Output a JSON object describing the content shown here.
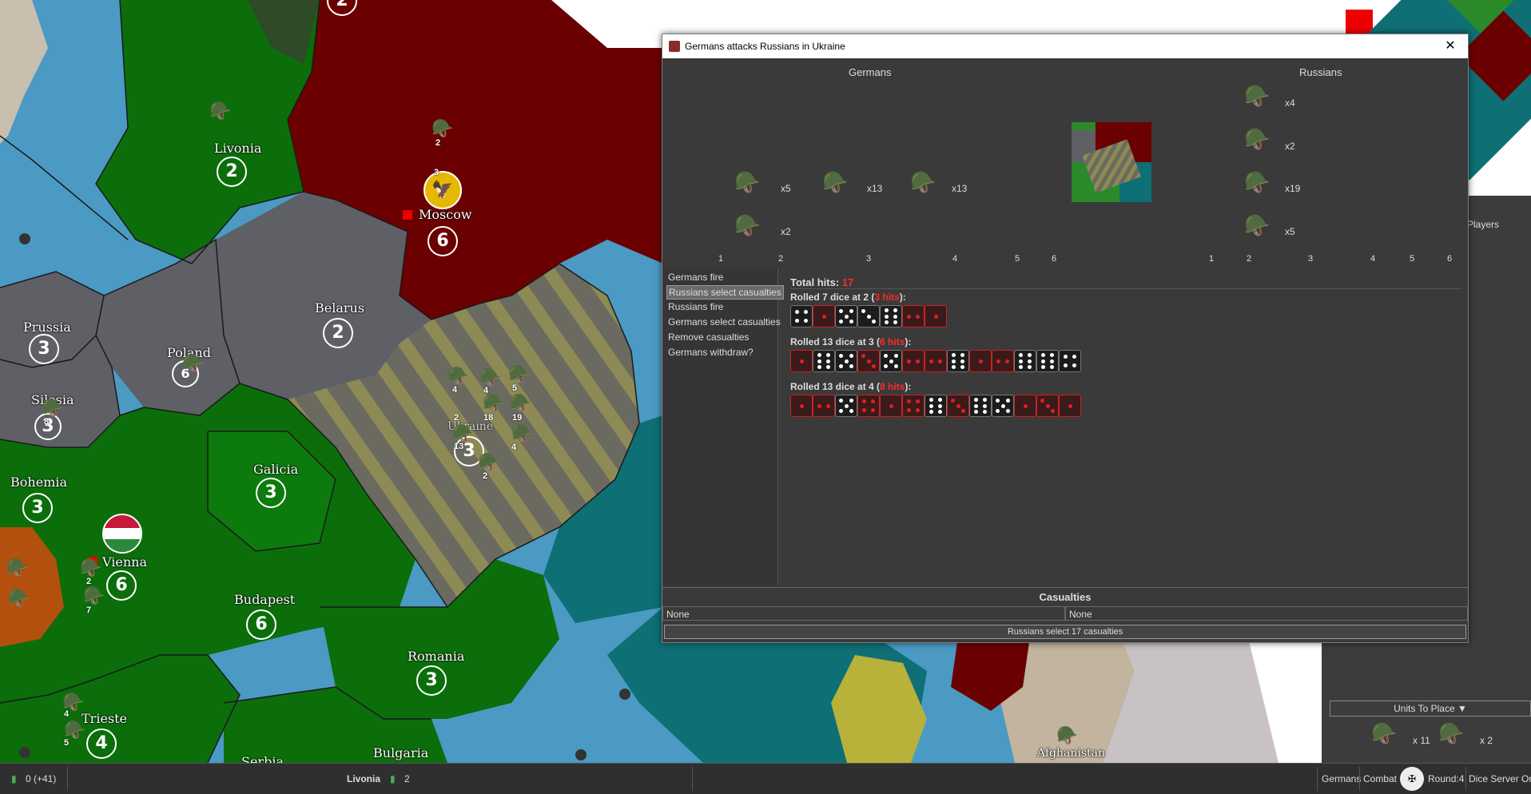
{
  "map": {
    "territories": [
      {
        "name": "Livonia",
        "pu": "2"
      },
      {
        "name": "Moscow",
        "pu": "6"
      },
      {
        "name": "Prussia",
        "pu": "3"
      },
      {
        "name": "Poland",
        "pu": "6"
      },
      {
        "name": "Belarus",
        "pu": "2"
      },
      {
        "name": "Silesia",
        "pu": "3"
      },
      {
        "name": "Ukraine",
        "pu": "3"
      },
      {
        "name": "Bohemia",
        "pu": "3"
      },
      {
        "name": "Galicia",
        "pu": "3"
      },
      {
        "name": "Vienna",
        "pu": "6"
      },
      {
        "name": "Budapest",
        "pu": "6"
      },
      {
        "name": "Romania",
        "pu": "3"
      },
      {
        "name": "Trieste",
        "pu": "4"
      },
      {
        "name": "Bulgaria",
        "pu": ""
      },
      {
        "name": "Serbia",
        "pu": ""
      },
      {
        "name": "Afghanistan",
        "pu": ""
      }
    ],
    "top_pu": "2",
    "unit_counts": {
      "moscow_top": "2",
      "moscow_mid": "3",
      "poland": "8",
      "ukraine_a": "4",
      "ukraine_b": "4",
      "ukraine_c": "5",
      "ukraine_d": "2",
      "ukraine_e": "18",
      "ukraine_f": "19",
      "ukraine_g": "13",
      "ukraine_h": "4",
      "ukraine_i": "2",
      "vienna_a": "2",
      "vienna_b": "7",
      "trieste_a": "4",
      "trieste_b": "5"
    },
    "colors": {
      "german": "#0b6e0b",
      "russian": "#6b0000",
      "neutral": "#5f5f66",
      "sea": "#4a9ac4",
      "teal": "#0e6f75"
    }
  },
  "dialog": {
    "title": "Germans attacks Russians in Ukraine",
    "close": "✕",
    "attacker": {
      "name": "Germans",
      "units": [
        {
          "icon": "infantry-icon",
          "count": "x5"
        },
        {
          "icon": "infantry-icon",
          "count": "x13"
        },
        {
          "icon": "artillery-icon",
          "count": "x13"
        },
        {
          "icon": "tank-icon",
          "count": "x2"
        }
      ],
      "scale": [
        "1",
        "2",
        "3",
        "4",
        "5",
        "6"
      ]
    },
    "defender": {
      "name": "Russians",
      "units": [
        {
          "icon": "infantry-icon",
          "count": "x4"
        },
        {
          "icon": "artillery-icon",
          "count": "x2"
        },
        {
          "icon": "artillery-icon",
          "count": "x19"
        },
        {
          "icon": "infantry-icon",
          "count": "x5"
        }
      ],
      "scale": [
        "1",
        "2",
        "3",
        "4",
        "5",
        "6"
      ]
    },
    "steps": [
      "Germans fire",
      "Russians select casualties",
      "Russians fire",
      "Germans select casualties",
      "Remove casualties",
      "Germans withdraw?"
    ],
    "selected_step": 1,
    "total_hits_label": "Total hits:",
    "total_hits": "17",
    "rolls": [
      {
        "prefix": "Rolled 7 dice at 2 (",
        "hits": "3 hits",
        "suffix": "):",
        "dice": [
          4,
          1,
          5,
          3,
          6,
          2,
          1
        ]
      },
      {
        "prefix": "Rolled 13 dice at 3 (",
        "hits": "6 hits",
        "suffix": "):",
        "dice": [
          1,
          6,
          5,
          3,
          5,
          2,
          2,
          6,
          1,
          2,
          6,
          6,
          4
        ]
      },
      {
        "prefix": "Rolled 13 dice at 4 (",
        "hits": "8 hits",
        "suffix": "):",
        "dice": [
          1,
          2,
          5,
          4,
          1,
          4,
          6,
          3,
          6,
          5,
          1,
          3,
          1
        ]
      }
    ],
    "casualties_title": "Casualties",
    "casualties_left": "None",
    "casualties_right": "None",
    "action_button": "Russians select 17 casualties"
  },
  "right_panel": {
    "players_label": "Players",
    "units_to_place_label": "Units To Place ▼",
    "units": [
      {
        "icon": "infantry-icon",
        "count": "x 11"
      },
      {
        "icon": "tank-icon",
        "count": "x 2"
      }
    ]
  },
  "statusbar": {
    "pus": "0 (+41)",
    "territory": "Livonia",
    "territory_pu": "2",
    "player": "Germans",
    "phase": "Combat",
    "round": "Round:4",
    "dice_server": "Dice Server On"
  }
}
